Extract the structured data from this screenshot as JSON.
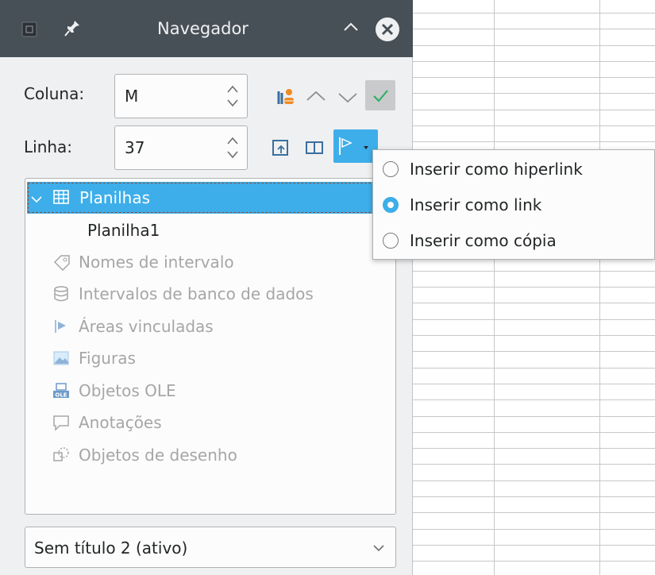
{
  "navigator": {
    "title": "Navegador",
    "column_label": "Coluna:",
    "column_value": "M",
    "row_label": "Linha:",
    "row_value": "37",
    "tree": {
      "root_label": "Planilhas",
      "sheet_item": "Planilha1",
      "categories": [
        {
          "label": "Nomes de intervalo",
          "icon": "tag-icon"
        },
        {
          "label": "Intervalos de banco de dados",
          "icon": "database-icon"
        },
        {
          "label": "Áreas vinculadas",
          "icon": "linked-area-icon"
        },
        {
          "label": "Figuras",
          "icon": "image-icon"
        },
        {
          "label": "Objetos OLE",
          "icon": "ole-object-icon"
        },
        {
          "label": "Anotações",
          "icon": "comment-icon"
        },
        {
          "label": "Objetos de desenho",
          "icon": "drawing-object-icon"
        }
      ]
    },
    "document_select": "Sem título 2 (ativo)"
  },
  "drag_mode_menu": {
    "items": [
      {
        "label": "Inserir como hiperlink",
        "selected": false
      },
      {
        "label": "Inserir como link",
        "selected": true
      },
      {
        "label": "Inserir como cópia",
        "selected": false
      }
    ]
  },
  "colors": {
    "titlebar": "#475057",
    "panel": "#eff0f1",
    "accent": "#3daee9",
    "disabled_text": "#a5a6a8"
  }
}
